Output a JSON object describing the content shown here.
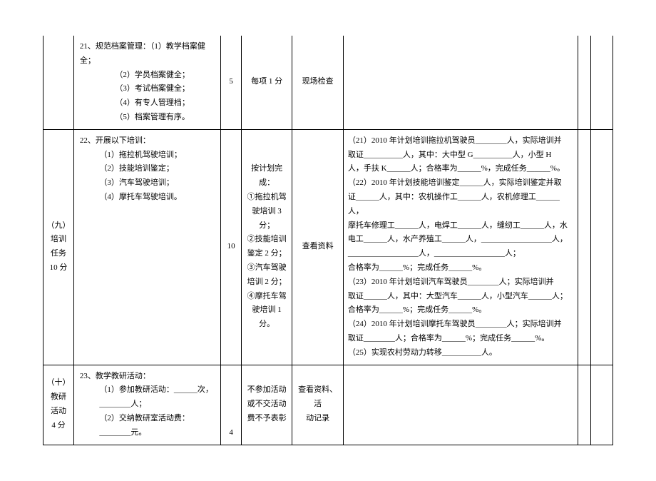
{
  "rows": [
    {
      "c1": "",
      "c2_main": "21、规范档案管理：（1）教学档案健全；",
      "c2_sub": [
        "（2）学员档案健全；",
        "（3）考试档案健全；",
        "（4）有专人管理档；",
        "（5）档案管理有序。"
      ],
      "c3": "5",
      "c4": "每项 1 分",
      "c5": "现场检查",
      "c6": "",
      "c7": "",
      "c8": ""
    },
    {
      "c1_lines": [
        "（九）",
        "培训",
        "任务",
        "10 分"
      ],
      "c2_main": "22、开展以下培训：",
      "c2_sub": [
        "（1）拖拉机驾驶培训；",
        "（2）技能培训鉴定；",
        "（3）汽车驾驶培训；",
        "（4）摩托车驾驶培训。"
      ],
      "c3": "10",
      "c4_lines": [
        "按计划完成：",
        "①拖拉机驾",
        "驶培训 3 分；",
        "②技能培训",
        "鉴定 2 分；",
        "③汽车驾驶",
        "培训 2 分；",
        "④摩托车驾",
        "驶培训 1 分。"
      ],
      "c5": "查看资料",
      "c6_lines": [
        "（21）2010 年计划培训拖拉机驾驶员________人，实际培训并",
        "取证__________人，其中：大中型 G__________人，小型 H",
        "人，手扶 K______人；合格率为______%，完成任务______%。",
        "（22）2010 年计划技能培训鉴定______人，实际培训鉴定并取",
        "证______人，其中：农机操作工______人，农机修理工______人，",
        "摩托车修理工______人，电焊工______人，缝纫工______人，水",
        "电工______人，水产养殖工______人，__________________人，",
        "__________________人，__________________人；",
        "合格率为______%；完成任务______%。",
        "（23）2010 年计划培训汽车驾驶员________人；实际培训并",
        "取证______人，其中：大型汽车______人，小型汽车______人；",
        "合格率为______%；完成任务______%。",
        "（24）2010 年计划培训摩托车驾驶员________人；实际培训并",
        "取证________人；合格率为______%；完成任务______%。",
        "（25）实现农村劳动力转移__________人。"
      ],
      "c7": "",
      "c8": ""
    },
    {
      "c1_lines": [
        "（十）",
        "教研",
        "活动",
        "4 分"
      ],
      "c2_main": "23、教学教研活动：",
      "c2_sub": [
        "（1）参加教研活动：______次，________人；",
        "（2）交纳教研室活动费：________元。"
      ],
      "c3": "4",
      "c4_lines": [
        "不参加活动",
        "或不交活动",
        "费不予表彰"
      ],
      "c5_lines": [
        "查看资料、活",
        "动记录"
      ],
      "c6": "",
      "c7": "",
      "c8": ""
    }
  ]
}
